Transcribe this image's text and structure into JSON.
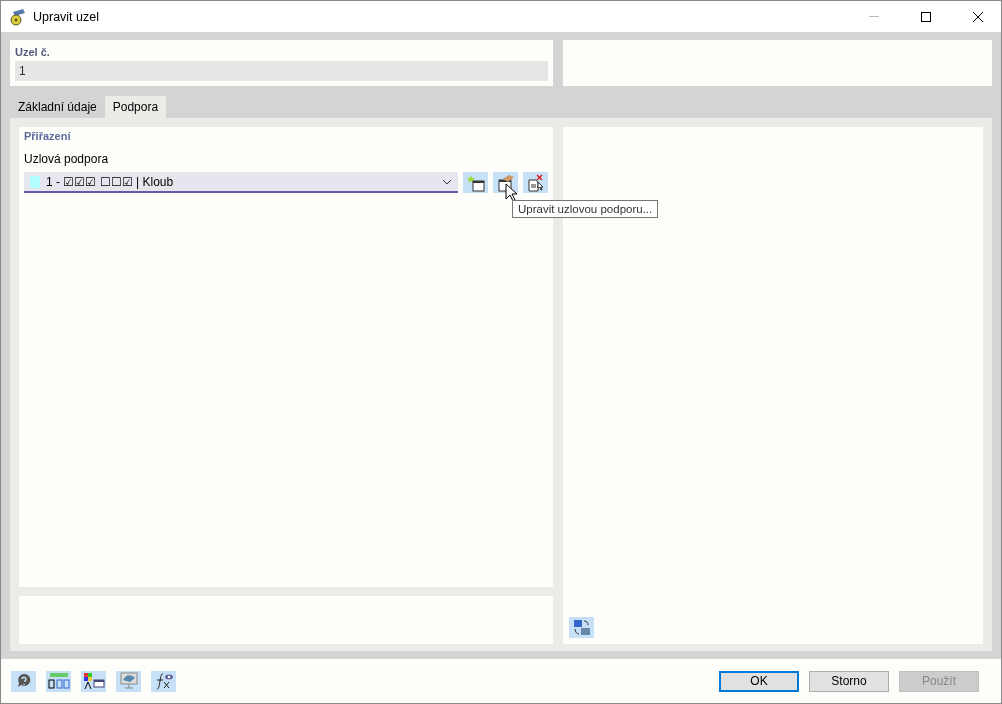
{
  "window": {
    "title": "Upravit uzel"
  },
  "node": {
    "label": "Uzel č.",
    "value": "1"
  },
  "tabs": [
    {
      "label": "Základní údaje",
      "selected": false
    },
    {
      "label": "Podpora",
      "selected": true
    }
  ],
  "section": {
    "title": "Přiřazení"
  },
  "support": {
    "label": "Uzlová podpora",
    "value": "1 - ☑☑☑ ☐☐☑ | Kloub"
  },
  "tooltip": "Upravit uzlovou podporu...",
  "buttons": [
    {
      "label": "OK",
      "default": true,
      "disabled": false
    },
    {
      "label": "Storno",
      "default": false,
      "disabled": false
    },
    {
      "label": "Použít",
      "default": false,
      "disabled": true
    }
  ]
}
